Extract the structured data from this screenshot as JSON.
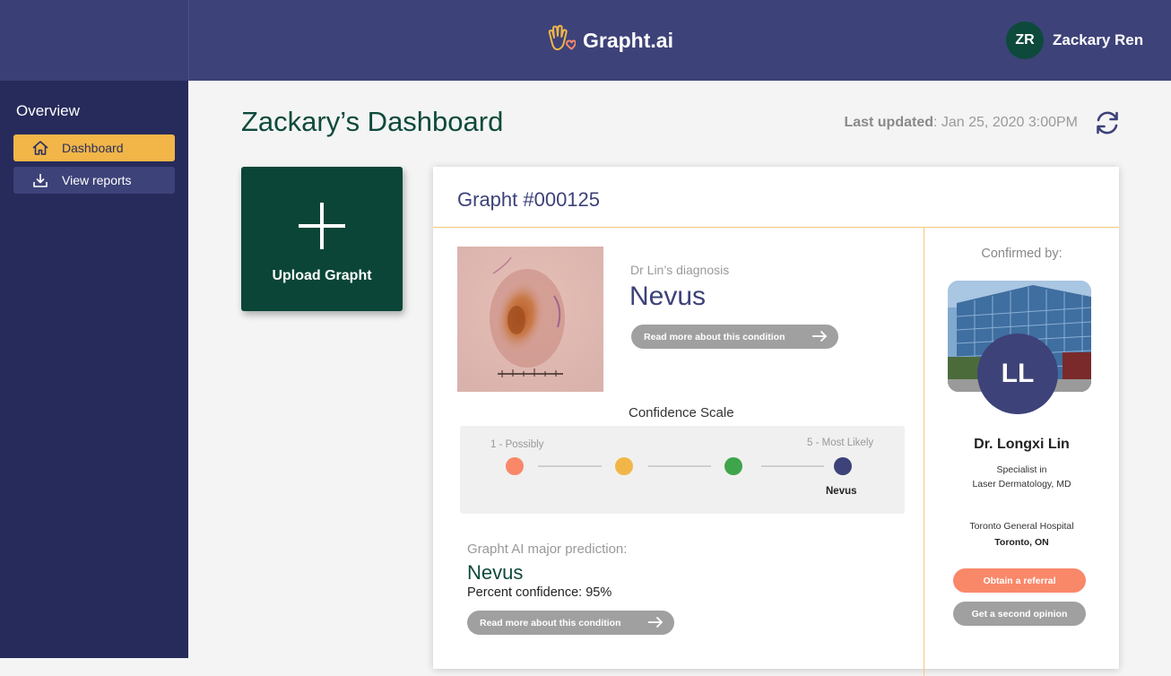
{
  "header": {
    "brand": "Grapht.ai",
    "user_initials": "ZR",
    "user_name": "Zackary Ren"
  },
  "sidebar": {
    "title": "Overview",
    "items": [
      {
        "label": "Dashboard",
        "icon": "home-icon",
        "active": true
      },
      {
        "label": "View reports",
        "icon": "download-icon",
        "active": false
      }
    ]
  },
  "main": {
    "title": "Zackary’s Dashboard",
    "last_updated_label": "Last updated",
    "last_updated_value": ": Jan 25, 2020 3:00PM",
    "upload_label": "Upload Grapht"
  },
  "card": {
    "title": "Grapht #000125",
    "diagnosis_label": "Dr Lin’s diagnosis",
    "diagnosis_value": "Nevus",
    "read_more": "Read more about this condition",
    "confidence": {
      "title": "Confidence Scale",
      "min_label": "1 - Possibly",
      "max_label": "5 - Most Likely",
      "selected_label": "Nevus",
      "level_colors": [
        "#f98869",
        "#f2b648",
        "#3fa54a",
        "#3d4279"
      ]
    },
    "ai": {
      "label": "Grapht AI major prediction:",
      "value": "Nevus",
      "confidence": "Percent confidence: 95%",
      "read_more": "Read more about this condition"
    },
    "doctor": {
      "confirmed_by": "Confirmed by:",
      "initials": "LL",
      "name": "Dr. Longxi Lin",
      "specialty_line1": "Specialist in",
      "specialty_line2": "Laser Dermatology, MD",
      "hospital": "Toronto General Hospital",
      "city": "Toronto, ON",
      "referral_button": "Obtain a referral",
      "second_opinion_button": "Get a second opinion"
    }
  },
  "colors": {
    "header": "#3d4279",
    "sidebar": "#272b5b",
    "accent": "#f2b648",
    "brand_green": "#0a4537",
    "coral": "#f98869"
  }
}
